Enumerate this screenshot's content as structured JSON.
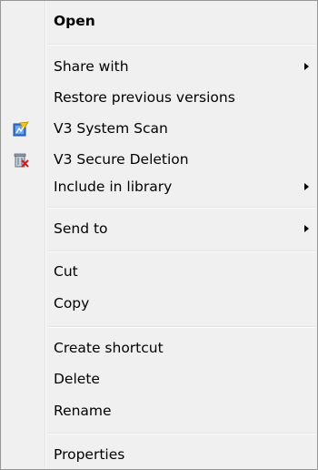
{
  "context_menu": {
    "items": [
      {
        "label": "Open"
      },
      {
        "label": "Share with"
      },
      {
        "label": "Restore previous versions"
      },
      {
        "label": "V3 System Scan",
        "icon": "v3-scan-icon"
      },
      {
        "label": "V3 Secure Deletion",
        "icon": "v3-secure-delete-icon"
      },
      {
        "label": "Include in library"
      },
      {
        "label": "Send to"
      },
      {
        "label": "Cut"
      },
      {
        "label": "Copy"
      },
      {
        "label": "Create shortcut"
      },
      {
        "label": "Delete"
      },
      {
        "label": "Rename"
      },
      {
        "label": "Properties"
      }
    ]
  }
}
